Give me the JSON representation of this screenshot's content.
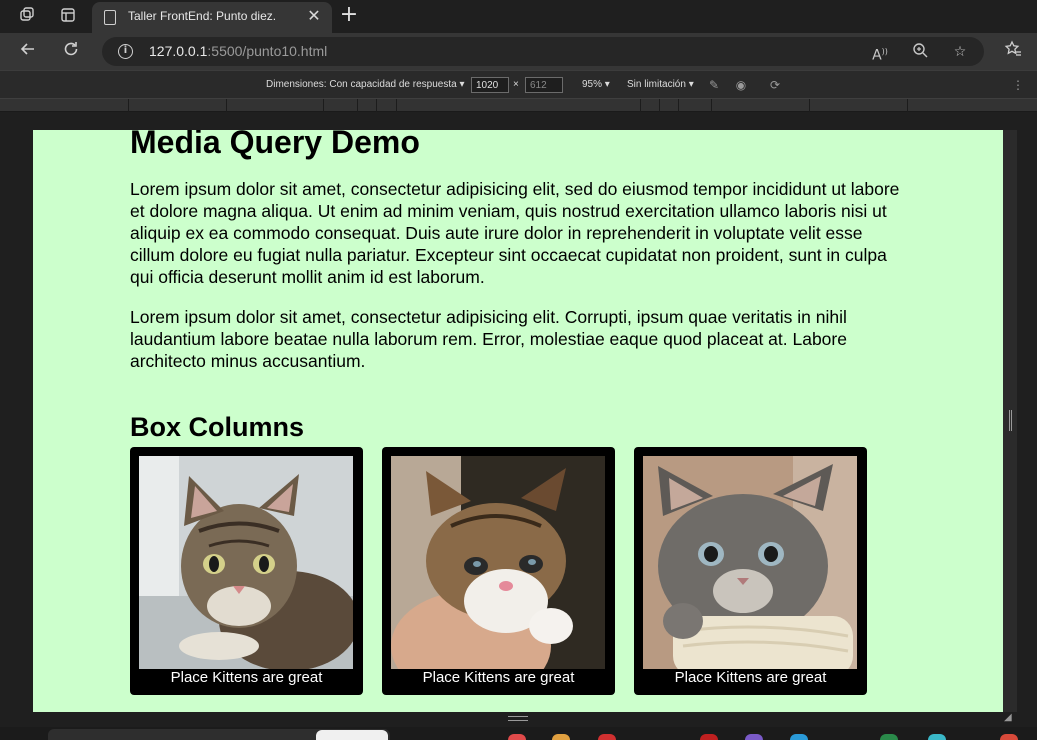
{
  "browser": {
    "tab_title": "Taller FrontEnd: Punto diez.",
    "url_host": "127.0.0.1",
    "url_path": ":5500/punto10.html"
  },
  "device_toolbar": {
    "dimensions_label": "Dimensiones: Con capacidad de respuesta",
    "width": "1020",
    "height": "612",
    "times": "×",
    "zoom": "95%",
    "throttling": "Sin limitación"
  },
  "page": {
    "title": "Media Query Demo",
    "paragraph_1": "Lorem ipsum dolor sit amet, consectetur adipisicing elit, sed do eiusmod tempor incididunt ut labore et dolore magna aliqua. Ut enim ad minim veniam, quis nostrud exercitation ullamco laboris nisi ut aliquip ex ea commodo consequat. Duis aute irure dolor in reprehenderit in voluptate velit esse cillum dolore eu fugiat nulla pariatur. Excepteur sint occaecat cupidatat non proident, sunt in culpa qui officia deserunt mollit anim id est laborum.",
    "paragraph_2": "Lorem ipsum dolor sit amet, consectetur adipisicing elit. Corrupti, ipsum quae veritatis in nihil laudantium labore beatae nulla laborum rem. Error, molestiae eaque quod placeat at. Labore architecto minus accusantium.",
    "section_title": "Box Columns",
    "cards": [
      {
        "caption": "Place Kittens are great"
      },
      {
        "caption": "Place Kittens are great"
      },
      {
        "caption": "Place Kittens are great"
      }
    ],
    "background_color": "#ccffcc"
  },
  "icons": {
    "workspaces": "workspaces-icon",
    "tab_actions": "tab-actions-icon",
    "back": "back-arrow-icon",
    "refresh": "refresh-icon",
    "info": "site-info-icon",
    "read_aloud": "read-aloud-icon",
    "zoom": "zoom-icon",
    "favorite": "favorite-star-icon",
    "favorites_bar": "favorites-icon"
  }
}
